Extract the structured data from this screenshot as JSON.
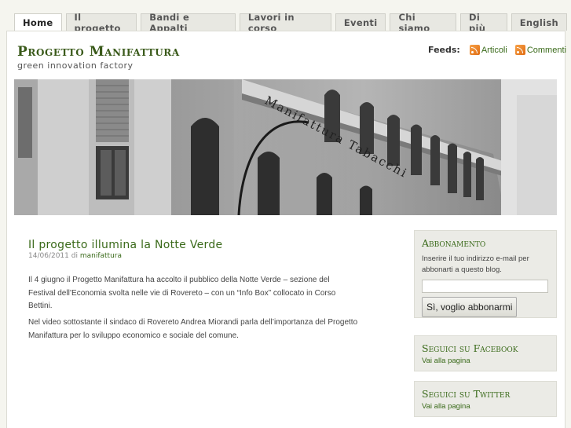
{
  "nav": {
    "tabs": [
      {
        "label": "Home"
      },
      {
        "label": "Il progetto"
      },
      {
        "label": "Bandi e Appalti"
      },
      {
        "label": "Lavori in corso"
      },
      {
        "label": "Eventi"
      },
      {
        "label": "Chi siamo"
      },
      {
        "label": "Di più"
      },
      {
        "label": "English"
      }
    ],
    "active_tab": "Home"
  },
  "header": {
    "site_title": "Progetto Manifattura",
    "tagline": "green innovation factory",
    "feeds_label": "Feeds:",
    "feed_articles": "Articoli",
    "feed_comments": "Commenti",
    "building_sign": "Manifattura Tabacchi"
  },
  "post": {
    "title": "Il progetto illumina la Notte Verde",
    "date": "14/06/2011",
    "by": "di",
    "author": "manifattura",
    "paragraphs": [
      "Il 4 giugno il Progetto Manifattura ha accolto il pubblico della Notte Verde – sezione del Festival dell’Economia svolta nelle vie di Rovereto – con un “Info Box” collocato in Corso Bettini.",
      "Nel video sottostante il sindaco di Rovereto Andrea Miorandi parla dell’importanza del Progetto Manifattura per lo sviluppo economico e sociale del comune."
    ]
  },
  "sidebar": {
    "subscribe": {
      "title": "Abbonamento",
      "text": "Inserire il tuo indirizzo e-mail per abbonarti a questo blog.",
      "email_value": "",
      "button": "Sì, voglio abbonarmi"
    },
    "facebook": {
      "title": "Seguici su Facebook",
      "link": "Vai alla pagina"
    },
    "twitter": {
      "title": "Seguici su Twitter",
      "link": "Vai alla pagina"
    }
  },
  "colors": {
    "accent_green": "#3a6a1a",
    "page_bg": "#f5f5ef",
    "widget_bg": "#ebebe6"
  }
}
